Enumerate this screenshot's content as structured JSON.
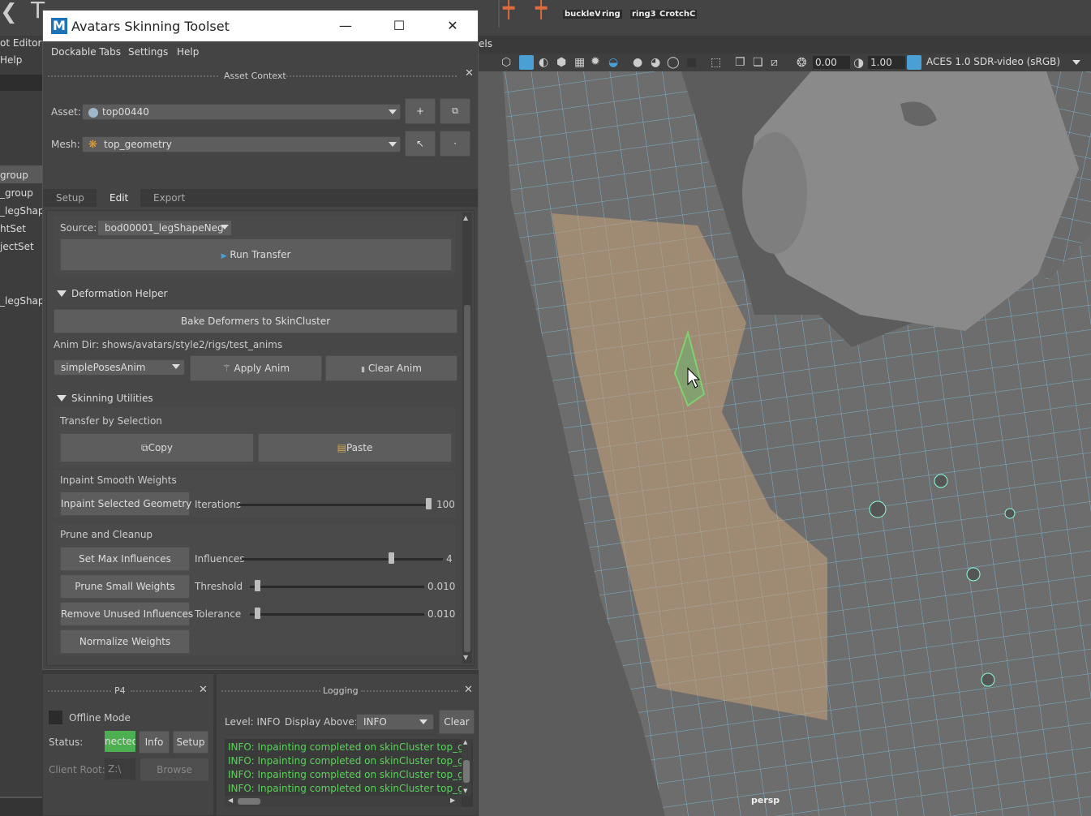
{
  "maya": {
    "shelf_labels": [
      "buckleV",
      "ring",
      "ring3",
      "CrotchC"
    ],
    "outliner_items": [
      "ot Editor",
      "Help",
      "group",
      "_group",
      "_legShape",
      "htSet",
      "jectSet",
      "_legShape"
    ],
    "panels_label": "els",
    "viewport_toolbar": {
      "value1": "0.00",
      "value2": "1.00",
      "color_space": "ACES 1.0 SDR-video (sRGB)"
    },
    "camera_label": "persp"
  },
  "window": {
    "logo": "M",
    "title": "Avatars Skinning Toolset",
    "minimize": "—",
    "maximize": "☐",
    "close": "✕"
  },
  "menubar": [
    "Dockable Tabs",
    "Settings",
    "Help"
  ],
  "asset_context": {
    "header": "Asset Context",
    "asset_label": "Asset:",
    "asset_value": "top00440",
    "mesh_label": "Mesh:",
    "mesh_value": "top_geometry",
    "add_btn": "+"
  },
  "tabs": [
    "Setup",
    "Edit",
    "Export"
  ],
  "active_tab": "Edit",
  "edit": {
    "source_label": "Source:",
    "source_value": "bod00001_legShapeNeg",
    "run_transfer": "Run Transfer",
    "deformation_header": "Deformation Helper",
    "bake_btn": "Bake Deformers to SkinCluster",
    "anim_dir": "Anim Dir: shows/avatars/style2/rigs/test_anims",
    "anim_select": "simplePosesAnim",
    "apply_anim": "Apply Anim",
    "clear_anim": "Clear Anim",
    "skinning_header": "Skinning Utilities",
    "transfer_by_selection": "Transfer by Selection",
    "copy": "Copy",
    "paste": "Paste",
    "inpaint_header": "Inpaint Smooth Weights",
    "inpaint_btn": "Inpaint Selected Geometry",
    "iterations_label": "Iterations",
    "iterations_value": "100",
    "iterations_level": 0.99,
    "prune_header": "Prune and Cleanup",
    "set_max_btn": "Set Max Influences",
    "influences_label": "Influences",
    "influences_value": "4",
    "influences_level": 0.74,
    "prune_btn": "Prune Small Weights",
    "threshold_label": "Threshold",
    "threshold_value": "0.010",
    "threshold_level": 0.04,
    "remove_btn": "Remove Unused Influences",
    "tolerance_label": "Tolerance",
    "tolerance_value": "0.010",
    "tolerance_level": 0.04,
    "normalize_btn": "Normalize Weights"
  },
  "p4": {
    "header": "P4",
    "offline_mode": "Offline Mode",
    "status_label": "Status:",
    "status_value": "nected",
    "info_btn": "Info",
    "setup_btn": "Setup",
    "client_root_label": "Client Root:",
    "client_root_value": "Z:\\",
    "browse_btn": "Browse"
  },
  "logging": {
    "header": "Logging",
    "level": "Level: INFO",
    "display_above_label": "Display Above:",
    "display_above_value": "INFO",
    "clear_btn": "Clear",
    "lines": [
      "INFO: Inpainting completed on skinCluster top_geom",
      "INFO: Inpainting completed on skinCluster top_geom",
      "INFO: Inpainting completed on skinCluster top_geom",
      "INFO: Inpainting completed on skinCluster top_geom"
    ]
  },
  "colors": {
    "log_green": "#58d458",
    "status_green": "#4caf50",
    "accent_blue": "#4a9fd5"
  }
}
